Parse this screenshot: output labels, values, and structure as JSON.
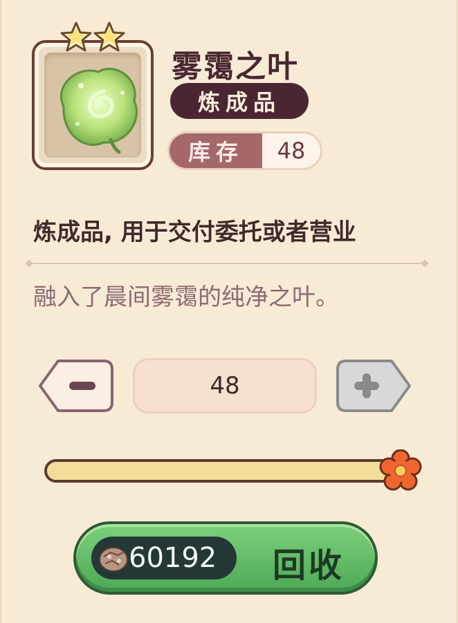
{
  "item": {
    "name": "雾霭之叶",
    "category": "炼成品",
    "stars": 2,
    "stock_label": "库存",
    "stock_value": "48",
    "icon": "leaf-icon"
  },
  "description": "炼成品, 用于交付委托或者营业",
  "flavor_text": "融入了晨间雾霭的纯净之叶。",
  "quantity": {
    "value": "48",
    "max": 48,
    "slider_fraction": 1.0
  },
  "action": {
    "price": "60192",
    "currency_icon": "stone-coin-icon",
    "label": "回收"
  },
  "colors": {
    "panel_bg": "#f8ebd6",
    "badge_bg": "#4a2632",
    "stock_label_bg": "#a4676a",
    "button_green": "#5fbf66",
    "title_text": "#4a2630"
  }
}
